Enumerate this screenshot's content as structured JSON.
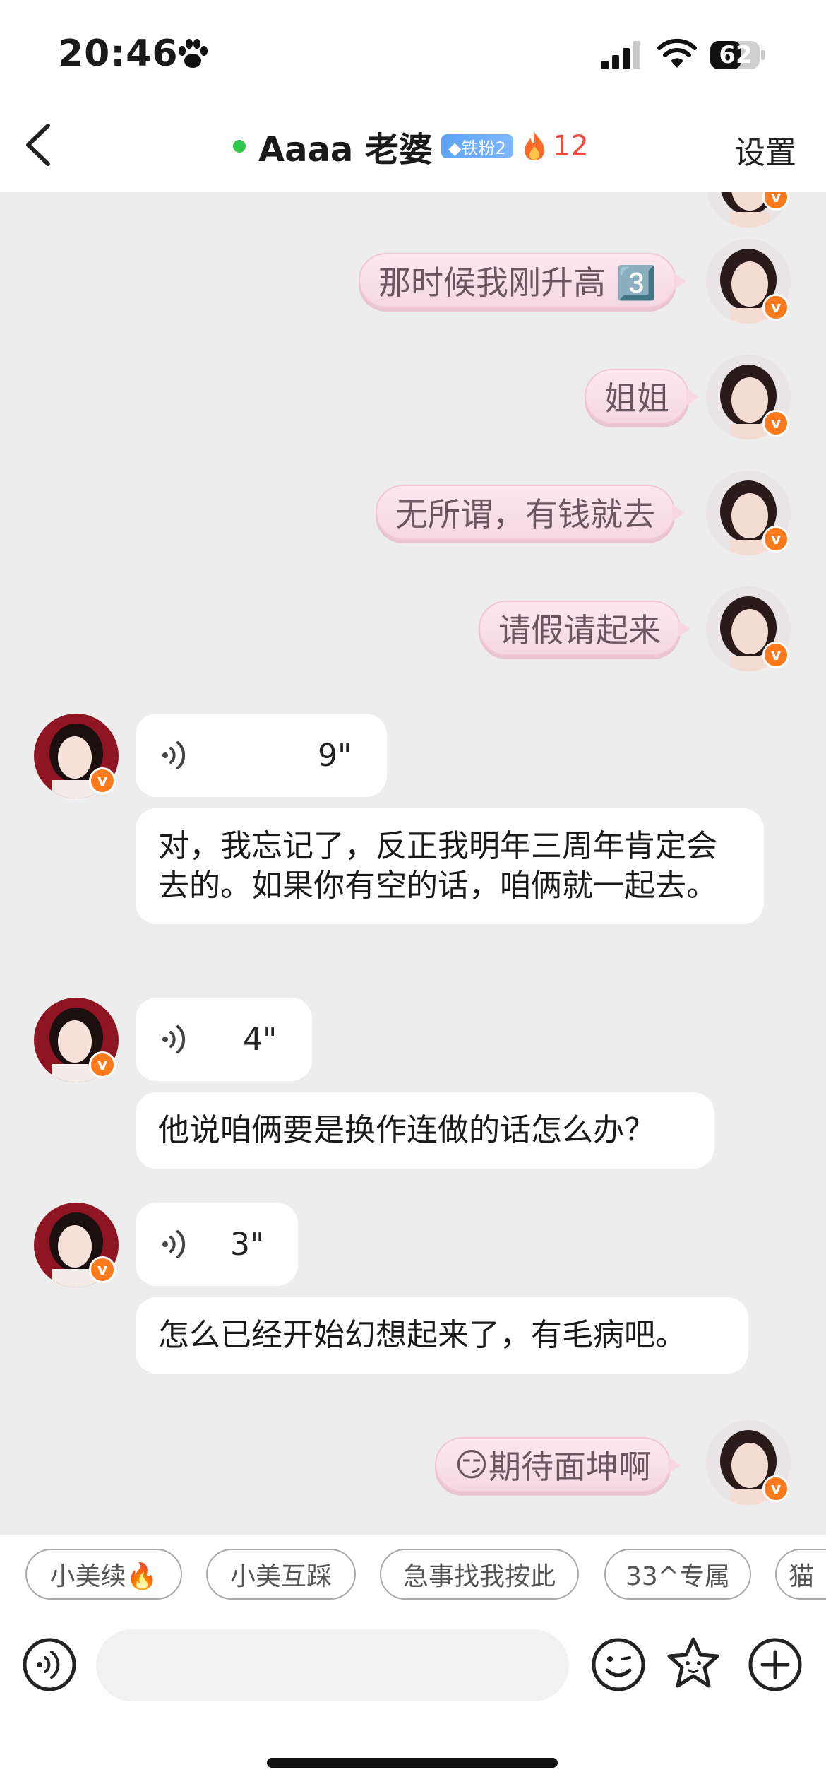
{
  "status_bar": {
    "time": "20:46",
    "battery": "62"
  },
  "header": {
    "title": "Aaaa 老婆",
    "fan_badge": "◆铁粉2",
    "streak": "12",
    "settings_label": "设置"
  },
  "messages": {
    "m1": "那时候我刚升高 3️⃣",
    "m2": "姐姐",
    "m3": "无所谓，有钱就去",
    "m4": "请假请起来",
    "voice1": "9\"",
    "text1": "对，我忘记了，反正我明年三周年肯定会去的。如果你有空的话，咱俩就一起去。",
    "voice2": "4\"",
    "text2": "他说咱俩要是换作连做的话怎么办？",
    "voice3": "3\"",
    "text3": "怎么已经开始幻想起来了，有毛病吧。",
    "m5_emoji": "😏",
    "m5": "期待面坤啊"
  },
  "badges": {
    "verified": "v"
  },
  "quick_replies": [
    "小美续🔥",
    "小美互踩",
    "急事找我按此",
    "33^专属",
    "猫"
  ],
  "colors": {
    "accent": "#ff7a1a",
    "online": "#2fc94b",
    "pink_bubble": "#f6d7e2",
    "streak": "#f04a3e"
  }
}
